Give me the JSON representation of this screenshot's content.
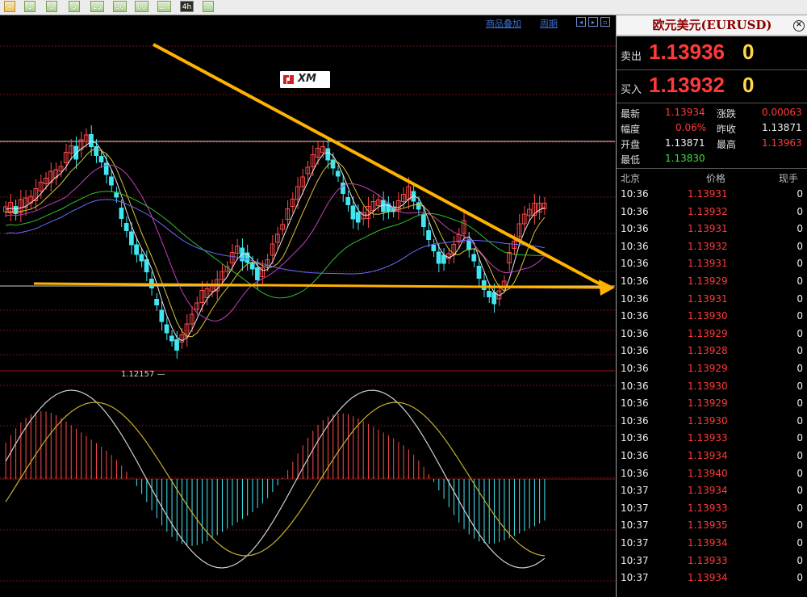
{
  "toolbar": {
    "buttons": [
      {
        "label": "✕",
        "kind": "close"
      },
      {
        "label": "1",
        "kind": "normal"
      },
      {
        "label": "3",
        "kind": "normal"
      },
      {
        "label": "5",
        "kind": "normal"
      },
      {
        "label": "15",
        "kind": "normal"
      },
      {
        "label": "30",
        "kind": "normal"
      },
      {
        "label": "60",
        "kind": "normal"
      },
      {
        "label": "2h",
        "kind": "normal"
      },
      {
        "label": "4h",
        "kind": "active"
      },
      {
        "label": "Y",
        "kind": "normal"
      }
    ]
  },
  "chart_header": {
    "overlay_link": "商品叠加",
    "cycle_link": "周期"
  },
  "chart": {
    "low_label": "1.12157",
    "logo_text": "XM",
    "colors": {
      "up": "#ff4a4a",
      "down": "#40e6f0",
      "trendline": "#ffb300",
      "grid": "#7a1010"
    }
  },
  "panel": {
    "title": "欧元美元(EURUSD)",
    "sell_label": "卖出",
    "sell_price": "1.13936",
    "sell_tail": "0",
    "buy_label": "买入",
    "buy_price": "1.13932",
    "buy_tail": "0",
    "info": {
      "latest_label": "最新",
      "latest": "1.13934",
      "change_label": "涨跌",
      "change": "0.00063",
      "range_label": "幅度",
      "range": "0.06%",
      "prev_label": "昨收",
      "prev": "1.13871",
      "open_label": "开盘",
      "open": "1.13871",
      "high_label": "最高",
      "high": "1.13963",
      "low_label": "最低",
      "low": "1.13830"
    },
    "ticks_header": {
      "time": "北京",
      "price": "价格",
      "volume": "现手"
    },
    "ticks": [
      {
        "time": "10:36",
        "price": "1.13931",
        "vol": "0"
      },
      {
        "time": "10:36",
        "price": "1.13932",
        "vol": "0"
      },
      {
        "time": "10:36",
        "price": "1.13931",
        "vol": "0"
      },
      {
        "time": "10:36",
        "price": "1.13932",
        "vol": "0"
      },
      {
        "time": "10:36",
        "price": "1.13931",
        "vol": "0"
      },
      {
        "time": "10:36",
        "price": "1.13929",
        "vol": "0"
      },
      {
        "time": "10:36",
        "price": "1.13931",
        "vol": "0"
      },
      {
        "time": "10:36",
        "price": "1.13930",
        "vol": "0"
      },
      {
        "time": "10:36",
        "price": "1.13929",
        "vol": "0"
      },
      {
        "time": "10:36",
        "price": "1.13928",
        "vol": "0"
      },
      {
        "time": "10:36",
        "price": "1.13929",
        "vol": "0"
      },
      {
        "time": "10:36",
        "price": "1.13930",
        "vol": "0"
      },
      {
        "time": "10:36",
        "price": "1.13929",
        "vol": "0"
      },
      {
        "time": "10:36",
        "price": "1.13930",
        "vol": "0"
      },
      {
        "time": "10:36",
        "price": "1.13933",
        "vol": "0"
      },
      {
        "time": "10:36",
        "price": "1.13934",
        "vol": "0"
      },
      {
        "time": "10:36",
        "price": "1.13940",
        "vol": "0"
      },
      {
        "time": "10:37",
        "price": "1.13934",
        "vol": "0"
      },
      {
        "time": "10:37",
        "price": "1.13933",
        "vol": "0"
      },
      {
        "time": "10:37",
        "price": "1.13935",
        "vol": "0"
      },
      {
        "time": "10:37",
        "price": "1.13934",
        "vol": "0"
      },
      {
        "time": "10:37",
        "price": "1.13933",
        "vol": "0"
      },
      {
        "time": "10:37",
        "price": "1.13934",
        "vol": "0"
      }
    ]
  }
}
